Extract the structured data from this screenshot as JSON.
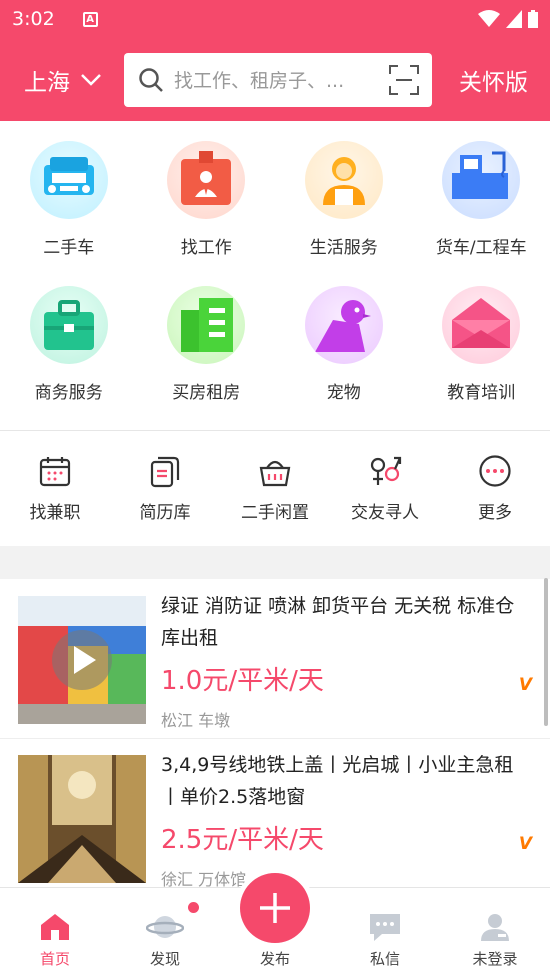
{
  "status": {
    "time": "3:02"
  },
  "header": {
    "city": "上海",
    "search_placeholder": "找工作、租房子、...",
    "care_mode": "关怀版"
  },
  "categories": [
    {
      "label": "二手车",
      "icon": "car-icon"
    },
    {
      "label": "找工作",
      "icon": "briefcase-person-icon"
    },
    {
      "label": "生活服务",
      "icon": "service-person-icon"
    },
    {
      "label": "货车/工程车",
      "icon": "truck-icon"
    },
    {
      "label": "商务服务",
      "icon": "business-bag-icon"
    },
    {
      "label": "买房租房",
      "icon": "building-icon"
    },
    {
      "label": "宠物",
      "icon": "pet-icon"
    },
    {
      "label": "教育培训",
      "icon": "education-envelope-icon"
    }
  ],
  "quick_links": [
    {
      "label": "找兼职",
      "icon": "calendar-icon"
    },
    {
      "label": "简历库",
      "icon": "resume-icon"
    },
    {
      "label": "二手闲置",
      "icon": "basket-icon"
    },
    {
      "label": "交友寻人",
      "icon": "gender-icon"
    },
    {
      "label": "更多",
      "icon": "more-dots-icon"
    }
  ],
  "listings": [
    {
      "title": "绿证 消防证 喷淋 卸货平台 无关税 标准仓库出租",
      "price": "1.0元/平米/天",
      "location": "松江 车墩",
      "badge": "V"
    },
    {
      "title": "3,4,9号线地铁上盖丨光启城丨小业主急租丨单价2.5落地窗",
      "price": "2.5元/平米/天",
      "location": "徐汇 万体馆",
      "badge": "V"
    }
  ],
  "nav": [
    {
      "label": "首页",
      "icon": "home-icon",
      "active": true
    },
    {
      "label": "发现",
      "icon": "planet-icon",
      "active": false
    },
    {
      "label": "发布",
      "icon": "plus-icon",
      "active": false
    },
    {
      "label": "私信",
      "icon": "chat-icon",
      "active": false
    },
    {
      "label": "未登录",
      "icon": "user-icon",
      "active": false
    }
  ],
  "colors": {
    "brand": "#f5496b",
    "price": "#f5496b",
    "badge": "#ff7a00"
  }
}
